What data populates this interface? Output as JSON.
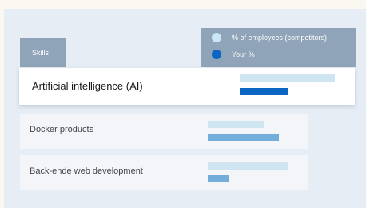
{
  "header": {
    "column_label": "Skills"
  },
  "legend": {
    "items": [
      {
        "label": "% of employees (competitors)",
        "color": "#c9e7f5"
      },
      {
        "label": "Your %",
        "color": "#0a66c2"
      }
    ]
  },
  "colors": {
    "competitors_bar": "#cfe6f2",
    "yours_bar_active": "#0a66c2",
    "yours_bar": "#73aedb"
  },
  "skills": [
    {
      "label": "Artificial intelligence (AI)",
      "selected": true,
      "competitors_pct": 100,
      "your_pct": 50
    },
    {
      "label": "Docker products",
      "selected": false,
      "competitors_pct": 59,
      "your_pct": 75
    },
    {
      "label": "Back-ende web development",
      "selected": false,
      "competitors_pct": 84,
      "your_pct": 23
    }
  ]
}
